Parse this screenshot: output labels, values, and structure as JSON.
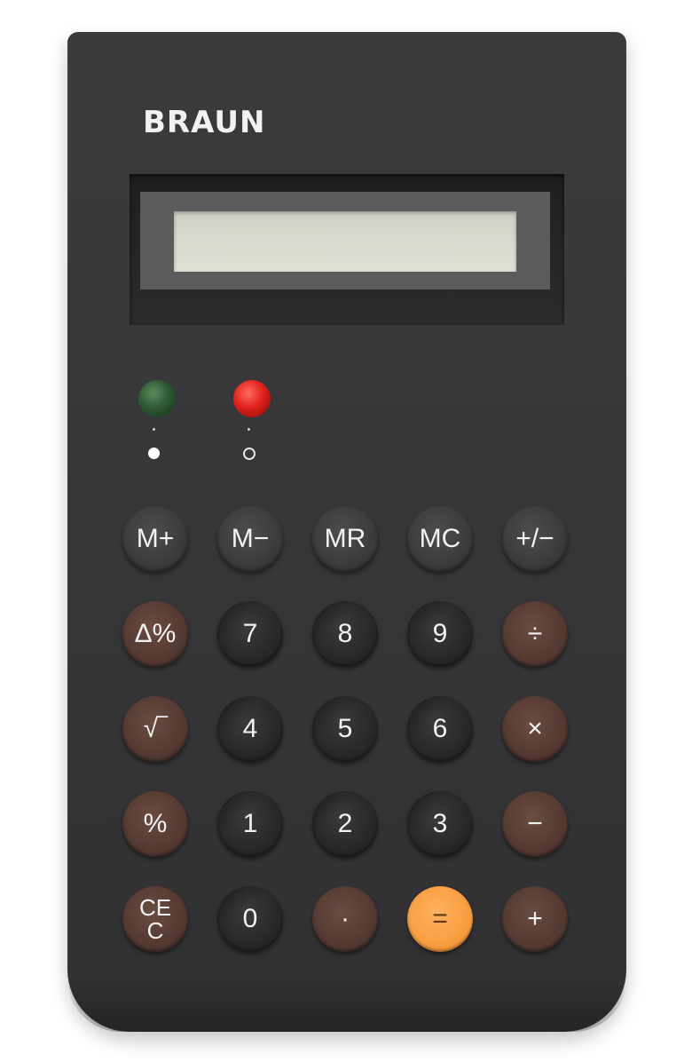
{
  "brand": "BRAUN",
  "display": {
    "value": ""
  },
  "indicators": [
    {
      "color": "#2e5a33",
      "symbol": "filled-dot"
    },
    {
      "color": "#e0221b",
      "symbol": "hollow-dot"
    }
  ],
  "keys": {
    "row1": [
      "M+",
      "M−",
      "MR",
      "MC",
      "+/−"
    ],
    "row2": [
      "Δ%",
      "7",
      "8",
      "9",
      "÷"
    ],
    "row3": [
      "√‾",
      "4",
      "5",
      "6",
      "×"
    ],
    "row4": [
      "%",
      "1",
      "2",
      "3",
      "−"
    ],
    "row5": [
      "CE C",
      "0",
      "·",
      "=",
      "+"
    ]
  },
  "colors": {
    "body": "#353537",
    "grey_key": "#373938",
    "black_key": "#262626",
    "brown_key": "#523830",
    "orange_key": "#f79c3d"
  }
}
